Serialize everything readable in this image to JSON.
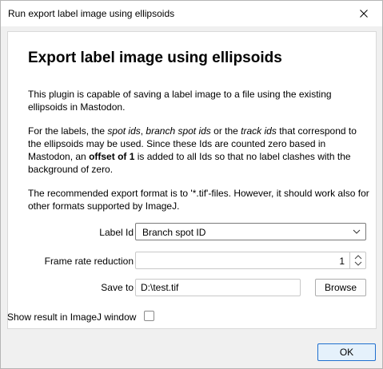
{
  "window": {
    "title": "Run export label image using ellipsoids"
  },
  "content": {
    "heading": "Export label image using ellipsoids",
    "paragraph1": "This plugin is capable of saving a label image to a file using the existing ellipsoids in Mastodon.",
    "paragraph2": {
      "t1": "For the labels, the ",
      "i1": "spot ids",
      "t2": ", ",
      "i2": "branch spot ids",
      "t3": " or the ",
      "i3": "track ids",
      "t4": " that correspond to the ellipsoids may be used. Since these Ids are counted zero based in Mastodon, an ",
      "b1": "offset of 1",
      "t5": " is added to all Ids so that no label clashes with the background of zero."
    },
    "paragraph3": "The recommended export format is to '*.tif'-files. However, it should work also for other formats supported by ImageJ."
  },
  "form": {
    "label_id": {
      "label": "Label Id",
      "value": "Branch spot ID"
    },
    "frame_rate": {
      "label": "Frame rate reduction",
      "value": "1"
    },
    "save_to": {
      "label": "Save to",
      "value": "D:\\test.tif",
      "browse_label": "Browse"
    },
    "show_result": {
      "label": "Show result in ImageJ window",
      "checked": false
    }
  },
  "footer": {
    "ok_label": "OK"
  }
}
